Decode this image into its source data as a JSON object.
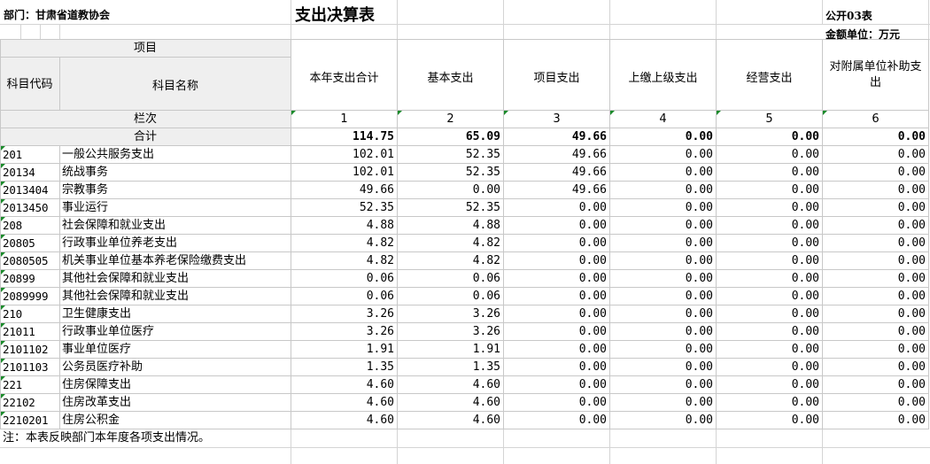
{
  "header": {
    "department": "部门：甘肃省道教协会",
    "title": "支出决算表",
    "form_code": "公开03表",
    "unit": "金额单位：万元"
  },
  "columns": {
    "item": "项目",
    "code": "科目代码",
    "name": "科目名称",
    "total": "本年支出合计",
    "basic": "基本支出",
    "project": "项目支出",
    "upper": "上缴上级支出",
    "business": "经营支出",
    "subsidy": "对附属单位补助支出"
  },
  "column_index": {
    "label": "栏次",
    "numbers": [
      "1",
      "2",
      "3",
      "4",
      "5",
      "6"
    ]
  },
  "sum_row": {
    "label": "合计",
    "values": [
      "114.75",
      "65.09",
      "49.66",
      "0.00",
      "0.00",
      "0.00"
    ]
  },
  "rows": [
    {
      "code": "201",
      "name": "一般公共服务支出",
      "values": [
        "102.01",
        "52.35",
        "49.66",
        "0.00",
        "0.00",
        "0.00"
      ]
    },
    {
      "code": "20134",
      "name": "统战事务",
      "values": [
        "102.01",
        "52.35",
        "49.66",
        "0.00",
        "0.00",
        "0.00"
      ]
    },
    {
      "code": "2013404",
      "name": "宗教事务",
      "values": [
        "49.66",
        "0.00",
        "49.66",
        "0.00",
        "0.00",
        "0.00"
      ]
    },
    {
      "code": "2013450",
      "name": "事业运行",
      "values": [
        "52.35",
        "52.35",
        "0.00",
        "0.00",
        "0.00",
        "0.00"
      ]
    },
    {
      "code": "208",
      "name": "社会保障和就业支出",
      "values": [
        "4.88",
        "4.88",
        "0.00",
        "0.00",
        "0.00",
        "0.00"
      ]
    },
    {
      "code": "20805",
      "name": "行政事业单位养老支出",
      "values": [
        "4.82",
        "4.82",
        "0.00",
        "0.00",
        "0.00",
        "0.00"
      ]
    },
    {
      "code": "2080505",
      "name": "机关事业单位基本养老保险缴费支出",
      "values": [
        "4.82",
        "4.82",
        "0.00",
        "0.00",
        "0.00",
        "0.00"
      ]
    },
    {
      "code": "20899",
      "name": "其他社会保障和就业支出",
      "values": [
        "0.06",
        "0.06",
        "0.00",
        "0.00",
        "0.00",
        "0.00"
      ]
    },
    {
      "code": "2089999",
      "name": "其他社会保障和就业支出",
      "values": [
        "0.06",
        "0.06",
        "0.00",
        "0.00",
        "0.00",
        "0.00"
      ]
    },
    {
      "code": "210",
      "name": "卫生健康支出",
      "values": [
        "3.26",
        "3.26",
        "0.00",
        "0.00",
        "0.00",
        "0.00"
      ]
    },
    {
      "code": "21011",
      "name": "行政事业单位医疗",
      "values": [
        "3.26",
        "3.26",
        "0.00",
        "0.00",
        "0.00",
        "0.00"
      ]
    },
    {
      "code": "2101102",
      "name": "事业单位医疗",
      "values": [
        "1.91",
        "1.91",
        "0.00",
        "0.00",
        "0.00",
        "0.00"
      ]
    },
    {
      "code": "2101103",
      "name": "公务员医疗补助",
      "values": [
        "1.35",
        "1.35",
        "0.00",
        "0.00",
        "0.00",
        "0.00"
      ]
    },
    {
      "code": "221",
      "name": "住房保障支出",
      "values": [
        "4.60",
        "4.60",
        "0.00",
        "0.00",
        "0.00",
        "0.00"
      ]
    },
    {
      "code": "22102",
      "name": "住房改革支出",
      "values": [
        "4.60",
        "4.60",
        "0.00",
        "0.00",
        "0.00",
        "0.00"
      ]
    },
    {
      "code": "2210201",
      "name": "住房公积金",
      "values": [
        "4.60",
        "4.60",
        "0.00",
        "0.00",
        "0.00",
        "0.00"
      ]
    }
  ],
  "note": "注：本表反映部门本年度各项支出情况。"
}
